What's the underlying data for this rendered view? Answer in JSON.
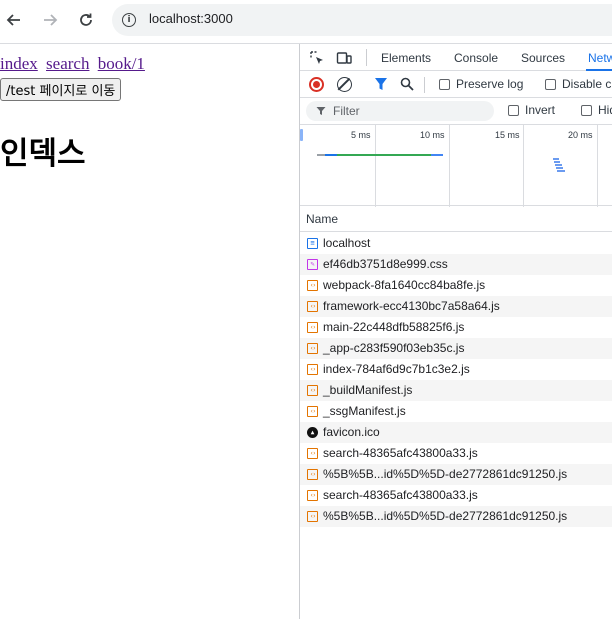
{
  "browser": {
    "url": "localhost:3000"
  },
  "page": {
    "links": [
      "index",
      "search",
      "book/1"
    ],
    "button_label": "/test 페이지로 이동",
    "heading": "인덱스"
  },
  "devtools": {
    "tabs": [
      {
        "label": "Elements",
        "active": false
      },
      {
        "label": "Console",
        "active": false
      },
      {
        "label": "Sources",
        "active": false
      },
      {
        "label": "Netw",
        "active": true
      }
    ],
    "preserve_log_label": "Preserve log",
    "disable_cache_label": "Disable c",
    "filter_placeholder": "Filter",
    "invert_label": "Invert",
    "hide_label": "Hid",
    "timeline_labels": [
      "5 ms",
      "10 ms",
      "15 ms",
      "20 ms"
    ],
    "name_column": "Name",
    "requests": [
      {
        "name": "localhost",
        "type": "document"
      },
      {
        "name": "ef46db3751d8e999.css",
        "type": "stylesheet"
      },
      {
        "name": "webpack-8fa1640cc84ba8fe.js",
        "type": "script"
      },
      {
        "name": "framework-ecc4130bc7a58a64.js",
        "type": "script"
      },
      {
        "name": "main-22c448dfb58825f6.js",
        "type": "script"
      },
      {
        "name": "_app-c283f590f03eb35c.js",
        "type": "script"
      },
      {
        "name": "index-784af6d9c7b1c3e2.js",
        "type": "script"
      },
      {
        "name": "_buildManifest.js",
        "type": "script"
      },
      {
        "name": "_ssgManifest.js",
        "type": "script"
      },
      {
        "name": "favicon.ico",
        "type": "icon"
      },
      {
        "name": "search-48365afc43800a33.js",
        "type": "script"
      },
      {
        "name": "%5B%5B...id%5D%5D-de2772861dc91250.js",
        "type": "script"
      },
      {
        "name": "search-48365afc43800a33.js",
        "type": "script"
      },
      {
        "name": "%5B%5B...id%5D%5D-de2772861dc91250.js",
        "type": "script"
      }
    ]
  },
  "colors": {
    "accent": "#1a73e8",
    "record": "#d93025",
    "link_visited": "#551a8b"
  }
}
